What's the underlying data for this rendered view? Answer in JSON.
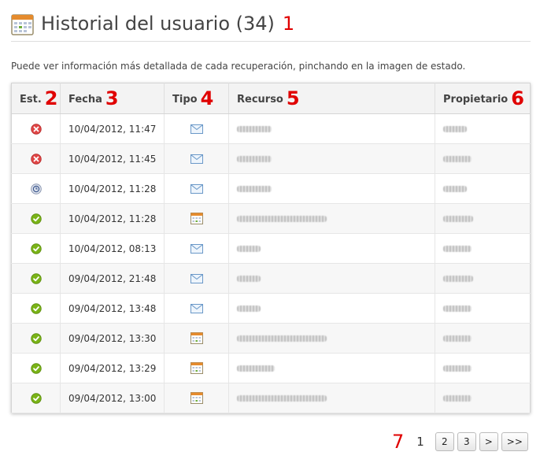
{
  "header": {
    "title": "Historial del usuario (34)",
    "annotation": "1",
    "icon": "calendar-icon"
  },
  "description": "Puede ver información más detallada de cada recuperación, pinchando en la imagen de estado.",
  "table": {
    "columns": [
      {
        "label": "Est.",
        "annotation": "2"
      },
      {
        "label": "Fecha",
        "annotation": "3"
      },
      {
        "label": "Tipo",
        "annotation": "4"
      },
      {
        "label": "Recurso",
        "annotation": "5"
      },
      {
        "label": "Propietario",
        "annotation": "6"
      }
    ],
    "rows": [
      {
        "status": "error",
        "date": "10/04/2012, 11:47",
        "type": "email"
      },
      {
        "status": "error",
        "date": "10/04/2012, 11:45",
        "type": "email"
      },
      {
        "status": "pending",
        "date": "10/04/2012, 11:28",
        "type": "email"
      },
      {
        "status": "ok",
        "date": "10/04/2012, 11:28",
        "type": "calendar"
      },
      {
        "status": "ok",
        "date": "10/04/2012, 08:13",
        "type": "email"
      },
      {
        "status": "ok",
        "date": "09/04/2012, 21:48",
        "type": "email"
      },
      {
        "status": "ok",
        "date": "09/04/2012, 13:48",
        "type": "email"
      },
      {
        "status": "ok",
        "date": "09/04/2012, 13:30",
        "type": "calendar"
      },
      {
        "status": "ok",
        "date": "09/04/2012, 13:29",
        "type": "calendar"
      },
      {
        "status": "ok",
        "date": "09/04/2012, 13:00",
        "type": "calendar"
      }
    ]
  },
  "pagination": {
    "annotation": "7",
    "current": "1",
    "pages": [
      "2",
      "3"
    ],
    "next": ">",
    "last": ">>"
  },
  "colors": {
    "error": "#e04646",
    "ok": "#7ab317",
    "pending": "#8a96b0",
    "annotation": "#e00000"
  }
}
